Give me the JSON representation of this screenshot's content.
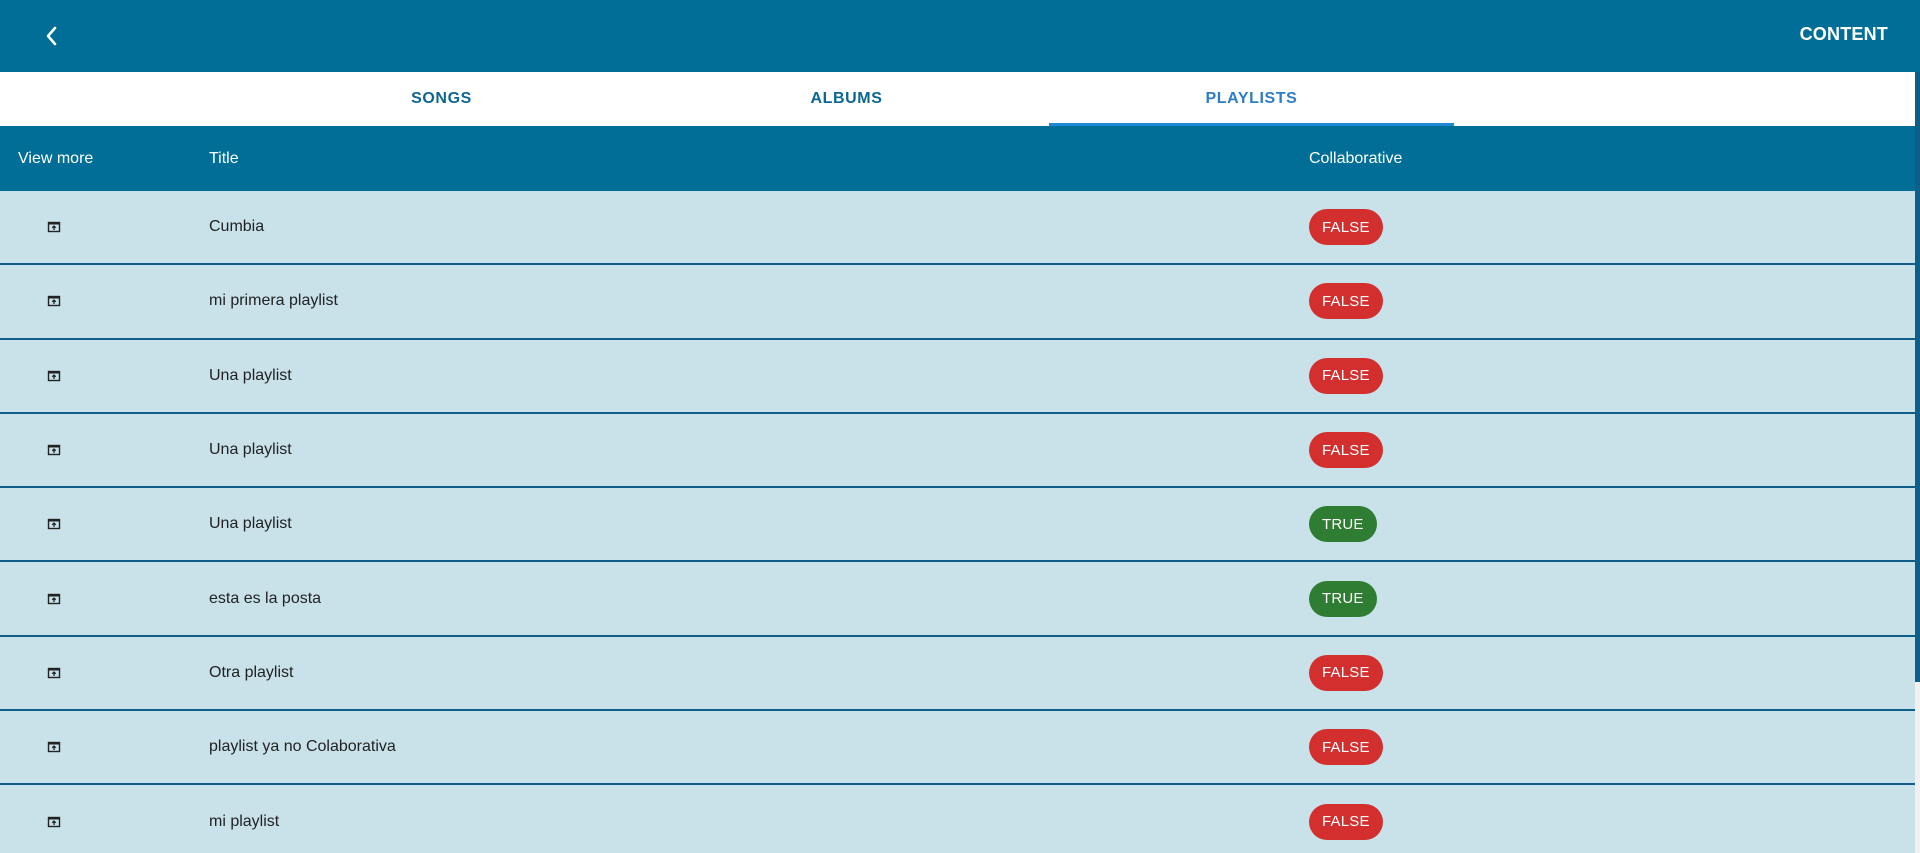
{
  "header": {
    "title": "CONTENT",
    "back_icon": "chevron-left-icon"
  },
  "tabs": [
    {
      "label": "SONGS",
      "active": false
    },
    {
      "label": "ALBUMS",
      "active": false
    },
    {
      "label": "PLAYLISTS",
      "active": true
    }
  ],
  "table": {
    "columns": [
      "View more",
      "Title",
      "Collaborative"
    ],
    "rows": [
      {
        "title": "Cumbia",
        "collaborative": "FALSE"
      },
      {
        "title": "mi primera playlist",
        "collaborative": "FALSE"
      },
      {
        "title": "Una playlist",
        "collaborative": "FALSE"
      },
      {
        "title": "Una playlist",
        "collaborative": "FALSE"
      },
      {
        "title": "Una playlist",
        "collaborative": "TRUE"
      },
      {
        "title": "esta es la posta",
        "collaborative": "TRUE"
      },
      {
        "title": "Otra playlist",
        "collaborative": "FALSE"
      },
      {
        "title": "playlist ya no Colaborativa",
        "collaborative": "FALSE"
      },
      {
        "title": "mi playlist",
        "collaborative": "FALSE"
      }
    ],
    "view_icon": "open-in-new-icon"
  },
  "colors": {
    "primary": "#006e96",
    "row_bg": "#c9e2ea",
    "false_badge": "#d32f2f",
    "true_badge": "#2e7d32",
    "tab_active": "#2f7dc3"
  }
}
